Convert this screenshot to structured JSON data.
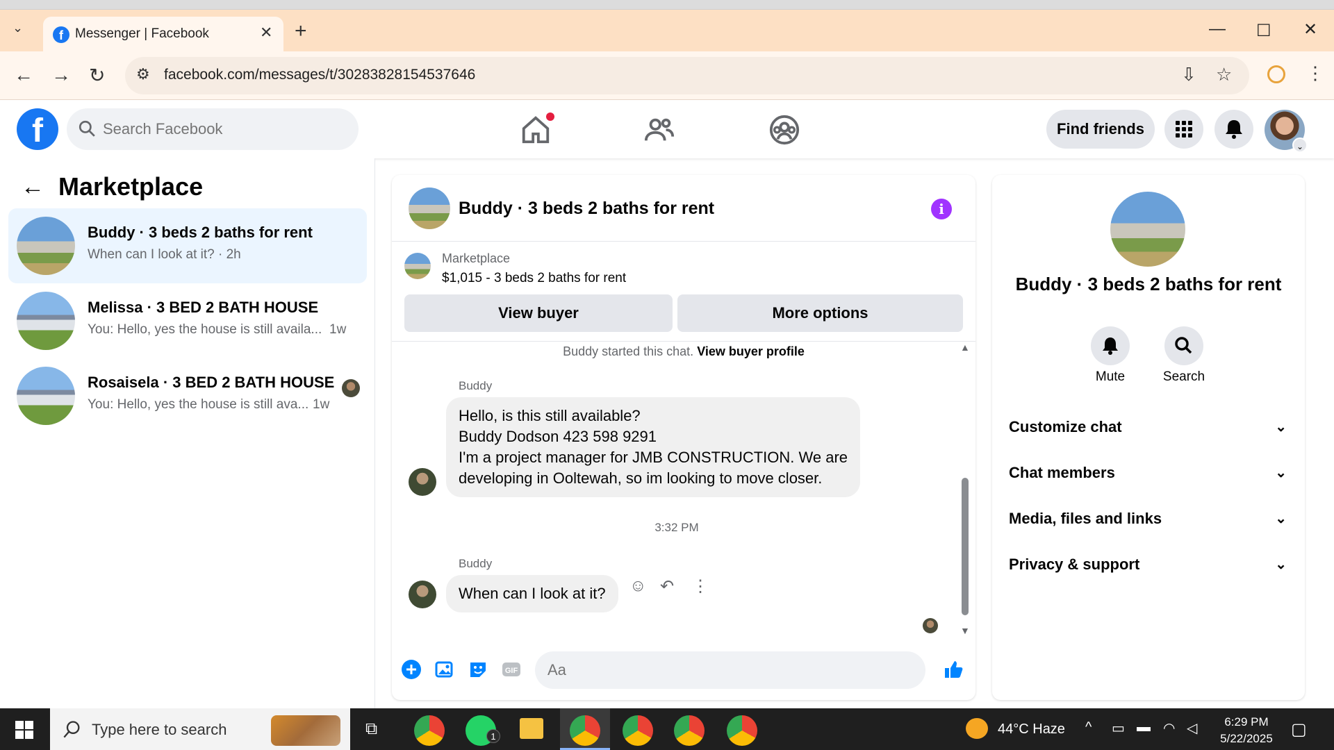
{
  "browser": {
    "tab_title": "Messenger | Facebook",
    "url": "facebook.com/messages/t/30283828154537646"
  },
  "fb_header": {
    "search_placeholder": "Search Facebook",
    "find_friends": "Find friends"
  },
  "left_panel": {
    "title": "Marketplace",
    "conversations": [
      {
        "name": "Buddy · 3 beds 2 baths for rent",
        "preview": "When can I look at it? · 2h",
        "time": "",
        "active": true
      },
      {
        "name": "Melissa · 3 BED 2 BATH HOUSE",
        "preview": "You: Hello, yes the house is still availa...",
        "time": "1w",
        "active": false
      },
      {
        "name": "Rosaisela · 3 BED 2 BATH HOUSE",
        "preview": "You: Hello, yes the house is still ava...",
        "time": "1w",
        "active": false
      }
    ]
  },
  "chat": {
    "title": "Buddy · 3 beds 2 baths for rent",
    "listing_category": "Marketplace",
    "listing_price": "$1,015 - 3 beds 2 baths for rent",
    "view_buyer": "View buyer",
    "more_options": "More options",
    "system_text": "Buddy started this chat.",
    "system_link": "View buyer profile",
    "messages": [
      {
        "sender": "Buddy",
        "lines": [
          "Hello, is this still available?",
          "Buddy Dodson 423 598 9291",
          "I'm a project manager for JMB CONSTRUCTION.  We are",
          "developing in Ooltewah, so im looking to move closer."
        ]
      },
      {
        "sender": "Buddy",
        "lines": [
          "When can I look at it?"
        ]
      }
    ],
    "timestamp": "3:32 PM",
    "input_placeholder": "Aa"
  },
  "right_panel": {
    "name": "Buddy · 3 beds 2 baths for rent",
    "mute": "Mute",
    "search": "Search",
    "sections": [
      "Customize chat",
      "Chat members",
      "Media, files and links",
      "Privacy & support"
    ]
  },
  "taskbar": {
    "search_placeholder": "Type here to search",
    "weather": "44°C  Haze",
    "time": "6:29 PM",
    "date": "5/22/2025",
    "whatsapp_badge": "1"
  },
  "colors": {
    "accent": "#1877f2",
    "messenger_blue": "#0084ff",
    "info_purple": "#a033ff",
    "active_row": "#ebf5ff",
    "tabbar": "#fde0c4"
  }
}
